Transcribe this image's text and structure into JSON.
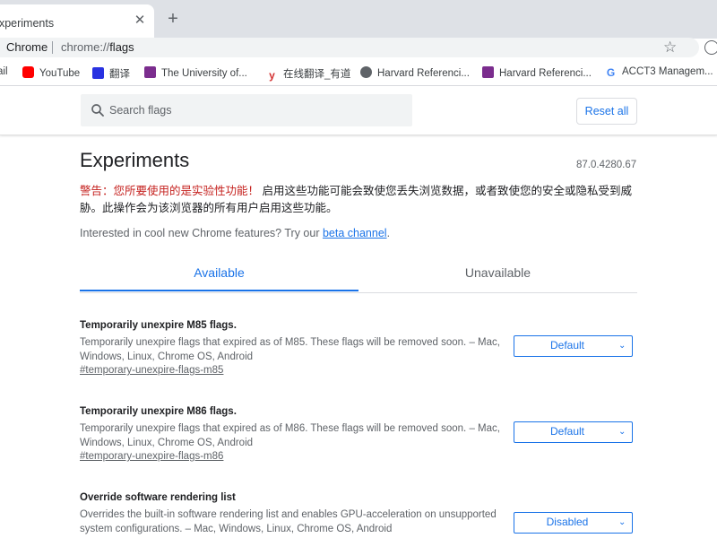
{
  "browser": {
    "tab_title": "experiments",
    "close_glyph": "✕",
    "new_tab_glyph": "+",
    "site_label": "Chrome",
    "url_scheme": "chrome://",
    "url_path": "flags",
    "bookmarks": [
      {
        "label": "ail",
        "icon": "gmail-icon",
        "color": "#ea4335"
      },
      {
        "label": "YouTube",
        "icon": "youtube-icon",
        "color": "#ff0000"
      },
      {
        "label": "翻译",
        "icon": "baidu-translate-icon",
        "color": "#2932e1"
      },
      {
        "label": "The University of...",
        "icon": "university-icon",
        "color": "#7b2d8e"
      },
      {
        "label": "在线翻译_有道",
        "icon": "youdao-icon",
        "color": "#d32f2f"
      },
      {
        "label": "Harvard Referenci...",
        "icon": "globe-icon",
        "color": "#5f6368"
      },
      {
        "label": "Harvard Referenci...",
        "icon": "university-icon",
        "color": "#7b2d8e"
      },
      {
        "label": "ACCT3 Managem...",
        "icon": "google-icon",
        "color": "#4285f4"
      }
    ]
  },
  "header": {
    "search_placeholder": "Search flags",
    "reset_label": "Reset all"
  },
  "main": {
    "title": "Experiments",
    "version": "87.0.4280.67",
    "warning_prefix": "警告：您所要使用的是实验性功能！",
    "warning_body": "启用这些功能可能会致使您丢失浏览数据，或者致使您的安全或隐私受到威胁。此操作会为该浏览器的所有用户启用这些功能。",
    "promo_text": "Interested in cool new Chrome features? Try our ",
    "promo_link": "beta channel",
    "promo_end": ".",
    "tabs": [
      {
        "label": "Available",
        "active": true
      },
      {
        "label": "Unavailable",
        "active": false
      }
    ],
    "flags": [
      {
        "name": "Temporarily unexpire M85 flags.",
        "description": "Temporarily unexpire flags that expired as of M85. These flags will be removed soon. – Mac, Windows, Linux, Chrome OS, Android",
        "link": "#temporary-unexpire-flags-m85",
        "value": "Default"
      },
      {
        "name": "Temporarily unexpire M86 flags.",
        "description": "Temporarily unexpire flags that expired as of M86. These flags will be removed soon. – Mac, Windows, Linux, Chrome OS, Android",
        "link": "#temporary-unexpire-flags-m86",
        "value": "Default"
      },
      {
        "name": "Override software rendering list",
        "description": "Overrides the built-in software rendering list and enables GPU-acceleration on unsupported system configurations. – Mac, Windows, Linux, Chrome OS, Android",
        "link": "",
        "value": "Disabled"
      }
    ],
    "chevron_glyph": "⌄"
  },
  "colors": {
    "accent": "#1a73e8",
    "warning": "#c5221f"
  }
}
